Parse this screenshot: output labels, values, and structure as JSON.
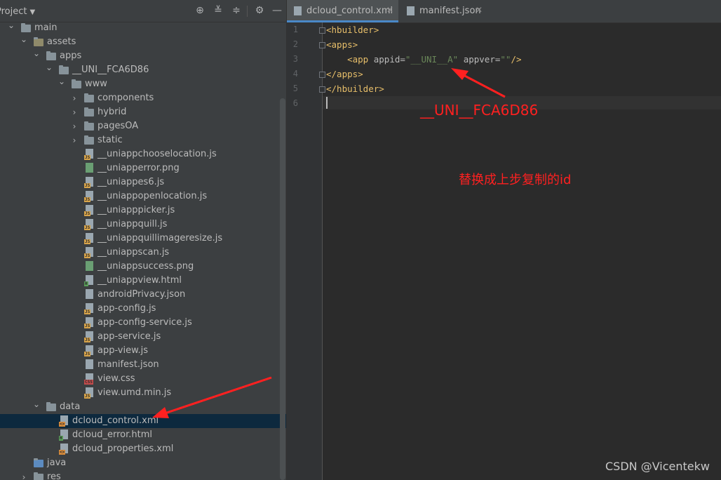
{
  "project_panel": {
    "title": "Project",
    "header_icons": [
      "locate-icon",
      "expand-all-icon",
      "collapse-all-icon",
      "settings-icon",
      "hide-icon"
    ],
    "tree": [
      {
        "label": "main",
        "type": "folder",
        "expanded": true,
        "depth": 0
      },
      {
        "label": "assets",
        "type": "folder",
        "expanded": true,
        "depth": 1
      },
      {
        "label": "apps",
        "type": "folder",
        "expanded": true,
        "depth": 2
      },
      {
        "label": "__UNI__FCA6D86",
        "type": "folder",
        "expanded": true,
        "depth": 3
      },
      {
        "label": "www",
        "type": "folder",
        "expanded": true,
        "depth": 4
      },
      {
        "label": "components",
        "type": "folder",
        "expanded": false,
        "depth": 5
      },
      {
        "label": "hybrid",
        "type": "folder",
        "expanded": false,
        "depth": 5
      },
      {
        "label": "pagesOA",
        "type": "folder",
        "expanded": false,
        "depth": 5
      },
      {
        "label": "static",
        "type": "folder",
        "expanded": false,
        "depth": 5
      },
      {
        "label": "__uniappchooselocation.js",
        "type": "js",
        "depth": 5
      },
      {
        "label": "__uniapperror.png",
        "type": "png",
        "depth": 5
      },
      {
        "label": "__uniappes6.js",
        "type": "js",
        "depth": 5
      },
      {
        "label": "__uniappopenlocation.js",
        "type": "js",
        "depth": 5
      },
      {
        "label": "__uniapppicker.js",
        "type": "js",
        "depth": 5
      },
      {
        "label": "__uniappquill.js",
        "type": "js",
        "depth": 5
      },
      {
        "label": "__uniappquillimageresize.js",
        "type": "js",
        "depth": 5
      },
      {
        "label": "__uniappscan.js",
        "type": "js",
        "depth": 5
      },
      {
        "label": "__uniappsuccess.png",
        "type": "png",
        "depth": 5
      },
      {
        "label": "__uniappview.html",
        "type": "html",
        "depth": 5
      },
      {
        "label": "androidPrivacy.json",
        "type": "json",
        "depth": 5
      },
      {
        "label": "app-config.js",
        "type": "js",
        "depth": 5
      },
      {
        "label": "app-config-service.js",
        "type": "js",
        "depth": 5
      },
      {
        "label": "app-service.js",
        "type": "js",
        "depth": 5
      },
      {
        "label": "app-view.js",
        "type": "js",
        "depth": 5
      },
      {
        "label": "manifest.json",
        "type": "json",
        "depth": 5
      },
      {
        "label": "view.css",
        "type": "css",
        "depth": 5
      },
      {
        "label": "view.umd.min.js",
        "type": "js",
        "depth": 5
      },
      {
        "label": "data",
        "type": "folder",
        "expanded": true,
        "depth": 2
      },
      {
        "label": "dcloud_control.xml",
        "type": "xml",
        "depth": 3,
        "selected": true
      },
      {
        "label": "dcloud_error.html",
        "type": "html",
        "depth": 3
      },
      {
        "label": "dcloud_properties.xml",
        "type": "xml",
        "depth": 3
      },
      {
        "label": "java",
        "type": "folder-blue",
        "depth": 1
      },
      {
        "label": "res",
        "type": "folder",
        "expanded": false,
        "depth": 1
      }
    ]
  },
  "editor": {
    "tabs": [
      {
        "label": "dcloud_control.xml",
        "active": true,
        "icon": "xml-file-icon"
      },
      {
        "label": "manifest.json",
        "active": false,
        "icon": "json-file-icon"
      }
    ],
    "line_numbers": [
      "1",
      "2",
      "3",
      "4",
      "5",
      "6"
    ],
    "code": [
      {
        "indent": "",
        "tag_open": "<hbuilder>"
      },
      {
        "indent": "",
        "tag_open": "<apps>"
      },
      {
        "indent": "    ",
        "tag_open": "<app ",
        "attr1": "appid=",
        "val1": "\"__UNI__A\"",
        "attr2": " appver=",
        "val2": "\"\"",
        "tag_close": "/>"
      },
      {
        "indent": "",
        "tag_open": "</apps>"
      },
      {
        "indent": "",
        "tag_open": "</hbuilder>"
      },
      {
        "indent": "",
        "tag_open": ""
      }
    ],
    "annotation_id": "__UNI__FCA6D86",
    "annotation_note": "替换成上步复制的id",
    "watermark": "CSDN @Vicentekw",
    "colors": {
      "arrow": "#ff2020",
      "selection": "#0d293e",
      "tab_underline": "#4a88c7"
    }
  }
}
